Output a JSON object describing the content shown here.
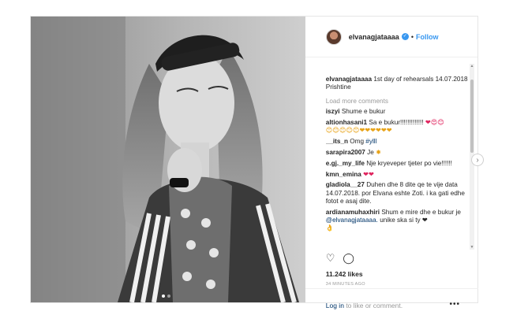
{
  "header": {
    "username": "elvanagjataaaa",
    "separator": "•",
    "follow_label": "Follow"
  },
  "caption": {
    "username": "elvanagjataaaa",
    "text": "1st day of rehearsals 14.07.2018",
    "location_line": "Prishtine"
  },
  "load_more_label": "Load more comments",
  "comments": [
    {
      "user": "iszyi",
      "text": "Shume e bukur"
    },
    {
      "user": "altionhasani1",
      "text": "Sa e bukur!!!!!!!!!!!!!",
      "emoji": "❤😍😊",
      "emoji2": "😊😊😊😊😊❤❤❤❤❤❤"
    },
    {
      "user": "__its_n",
      "text": "Omg",
      "hashtag": "#ylll"
    },
    {
      "user": "sarapira2007",
      "text": "Je",
      "emoji": "✸"
    },
    {
      "user": "e.gj._my_life",
      "text": "Nje kryeveper tjeter po vie!!!!!!"
    },
    {
      "user": "kmn_emina",
      "text": "",
      "emoji": "❤❤"
    },
    {
      "user": "gladiola__27",
      "text": "Duhen dhe 8 dite qe te vije data 14.07.2018. por Elvana eshte Zoti. i ka gati edhe fotot e asaj dite."
    },
    {
      "user": "ardianamuhaxhiri",
      "text": "Shum e mire dhe e bukur je",
      "mention": "@elvanagjataaaa.",
      "text2": "unike ska si ty ❤",
      "emoji2": "👌"
    }
  ],
  "actions": {
    "like_icon": "heart-outline-icon",
    "comment_icon": "comment-bubble-icon"
  },
  "likes_label": "11.242 likes",
  "timestamp": "34 MINUTES AGO",
  "footer": {
    "login_link": "Log in",
    "login_text": "to like or comment.",
    "more_icon": "•••"
  },
  "colors": {
    "accent_blue": "#3897f0",
    "link_dark": "#003569",
    "border": "#e6e6e6",
    "muted": "#999999"
  }
}
